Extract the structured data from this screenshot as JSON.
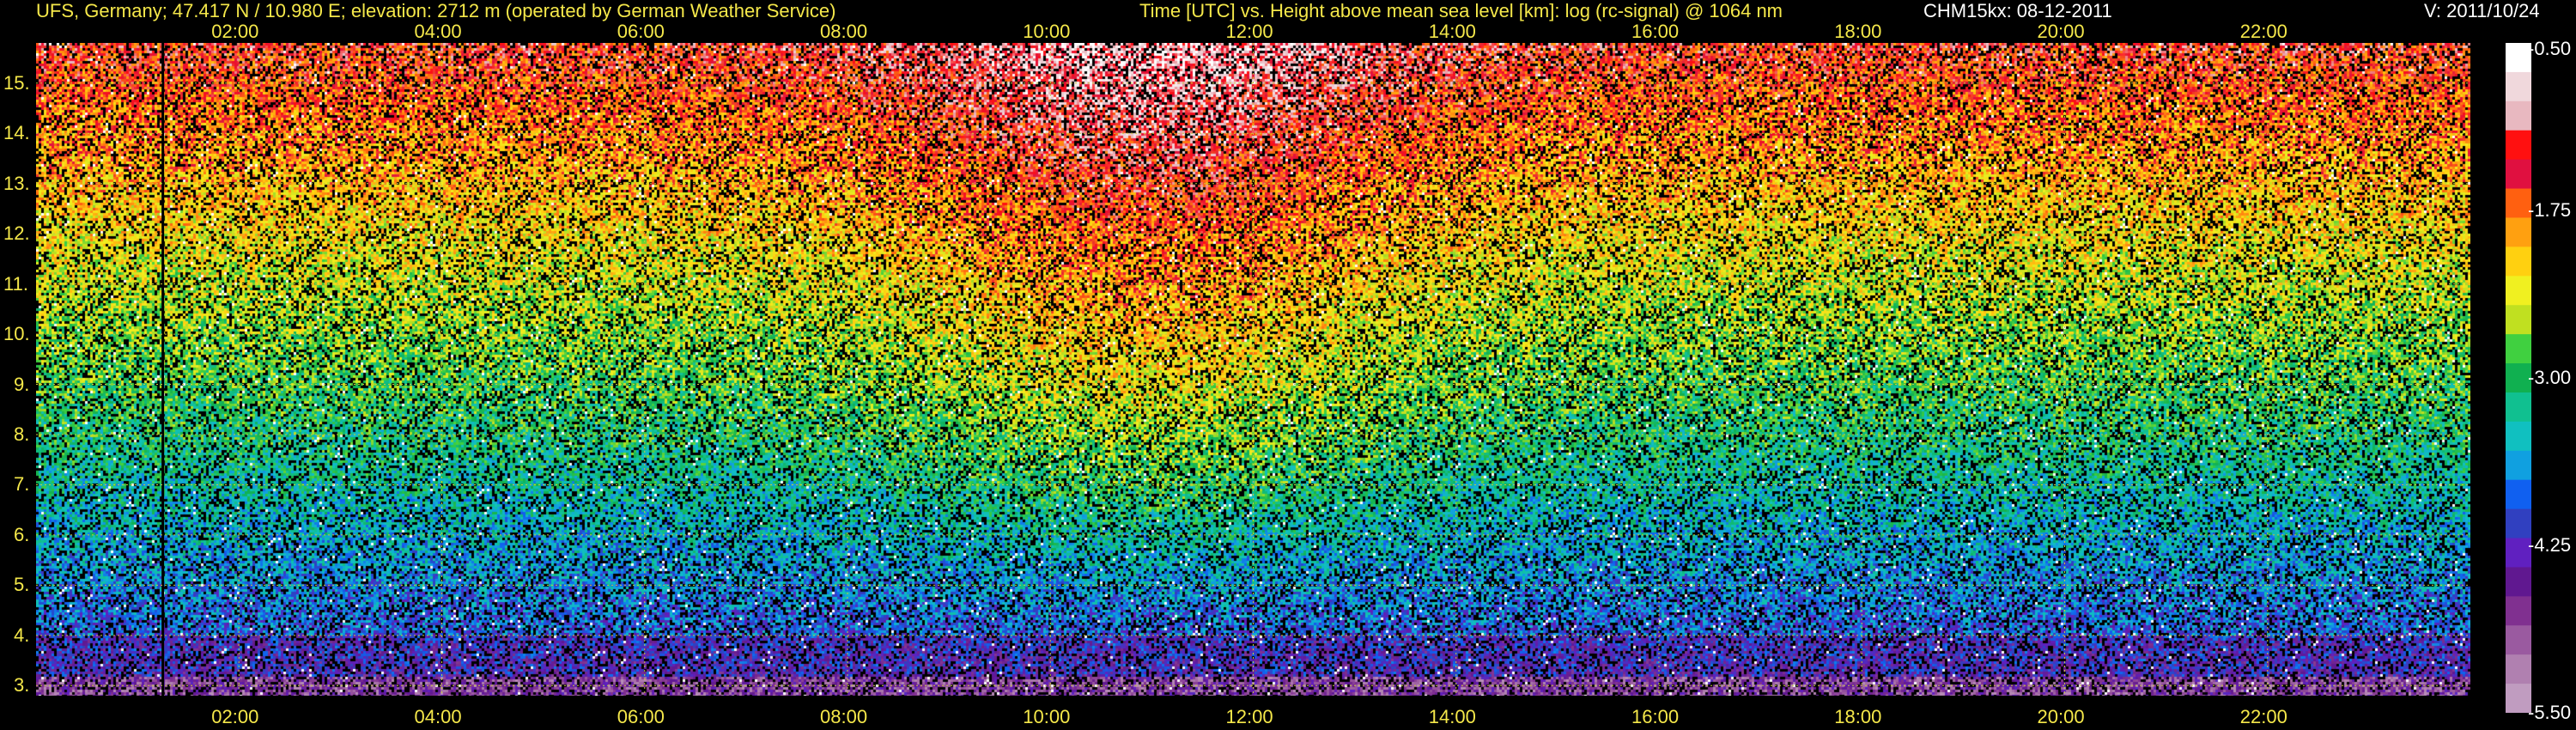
{
  "header": {
    "station": "UFS, Germany; 47.417 N / 10.980 E; elevation: 2712 m  (operated by German Weather Service)",
    "title": "Time [UTC] vs. Height above mean sea level [km]: log (rc-signal) @ 1064 nm",
    "instrument": "CHM15kx: 08-12-2011",
    "version": "V: 2011/10/24"
  },
  "colors": {
    "text_yellow": "#f5e84a",
    "grid": "#c8c83c",
    "background": "#000000"
  },
  "chart_data": {
    "type": "heatmap",
    "title": "Time [UTC] vs. Height above mean sea level [km]: log (rc-signal) @ 1064 nm",
    "xlabel": "Time [UTC]",
    "ylabel": "Height above mean sea level [km]",
    "xlim": [
      0,
      24
    ],
    "ylim": [
      2.8,
      15.8
    ],
    "xtick_labels": [
      "02:00",
      "04:00",
      "06:00",
      "08:00",
      "10:00",
      "12:00",
      "14:00",
      "16:00",
      "18:00",
      "20:00",
      "22:00"
    ],
    "xticks": [
      2,
      4,
      6,
      8,
      10,
      12,
      14,
      16,
      18,
      20,
      22
    ],
    "ytick_labels": [
      "3.",
      "4.",
      "5.",
      "6.",
      "7.",
      "8.",
      "9.",
      "10.",
      "11.",
      "12.",
      "13.",
      "14.",
      "15."
    ],
    "yticks": [
      3,
      4,
      5,
      6,
      7,
      8,
      9,
      10,
      11,
      12,
      13,
      14,
      15
    ],
    "grid": true,
    "data_gap_time": 1.25,
    "colorbar": {
      "range": [
        -5.5,
        -0.5
      ],
      "tick_labels": [
        "-0.50",
        "-1.75",
        "-3.00",
        "-4.25",
        "-5.50"
      ],
      "ticks": [
        -0.5,
        -1.75,
        -3.0,
        -4.25,
        -5.5
      ],
      "colors": [
        "#ffffff",
        "#f0d8dc",
        "#e8b8c0",
        "#ff1010",
        "#e01040",
        "#ff6010",
        "#ffa010",
        "#ffd010",
        "#f0f020",
        "#c0e020",
        "#40d040",
        "#10b050",
        "#10c090",
        "#10c0c0",
        "#10a0e0",
        "#1060f0",
        "#3040c0",
        "#6020c0",
        "#601890",
        "#803090",
        "#9a5aa0",
        "#b080b0",
        "#c09cc0"
      ]
    }
  }
}
